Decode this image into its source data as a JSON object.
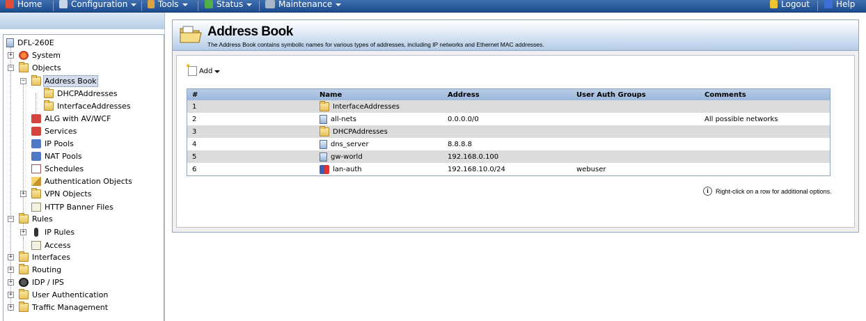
{
  "menubar": {
    "home": "Home",
    "configuration": "Configuration",
    "tools": "Tools",
    "status": "Status",
    "maintenance": "Maintenance",
    "logout": "Logout",
    "help": "Help"
  },
  "tree": {
    "root": "DFL-260E",
    "system": "System",
    "objects": "Objects",
    "address_book": "Address Book",
    "dhcp_addresses": "DHCPAddresses",
    "interface_addresses": "InterfaceAddresses",
    "alg": "ALG with AV/WCF",
    "services": "Services",
    "ip_pools": "IP Pools",
    "nat_pools": "NAT Pools",
    "schedules": "Schedules",
    "auth_objects": "Authentication Objects",
    "vpn_objects": "VPN Objects",
    "http_banner": "HTTP Banner Files",
    "rules": "Rules",
    "ip_rules": "IP Rules",
    "access": "Access",
    "interfaces": "Interfaces",
    "routing": "Routing",
    "idp_ips": "IDP / IPS",
    "user_auth": "User Authentication",
    "traffic_mgmt": "Traffic Management"
  },
  "header": {
    "title": "Address Book",
    "description": "The Address Book contains symbolic names for various types of addresses, including IP networks and Ethernet MAC addresses."
  },
  "toolbar": {
    "add_label": "Add"
  },
  "table": {
    "columns": [
      "#",
      "Name",
      "Address",
      "User Auth Groups",
      "Comments"
    ],
    "rows": [
      {
        "num": "1",
        "name": "InterfaceAddresses",
        "address": "",
        "groups": "",
        "comments": ""
      },
      {
        "num": "2",
        "name": "all-nets",
        "address": "0.0.0.0/0",
        "groups": "",
        "comments": "All possible networks"
      },
      {
        "num": "3",
        "name": "DHCPAddresses",
        "address": "",
        "groups": "",
        "comments": ""
      },
      {
        "num": "4",
        "name": "dns_server",
        "address": "8.8.8.8",
        "groups": "",
        "comments": ""
      },
      {
        "num": "5",
        "name": "gw-world",
        "address": "192.168.0.100",
        "groups": "",
        "comments": ""
      },
      {
        "num": "6",
        "name": "lan-auth",
        "address": "192.168.10.0/24",
        "groups": "webuser",
        "comments": ""
      }
    ]
  },
  "hint": "Right-click on a row for additional options."
}
